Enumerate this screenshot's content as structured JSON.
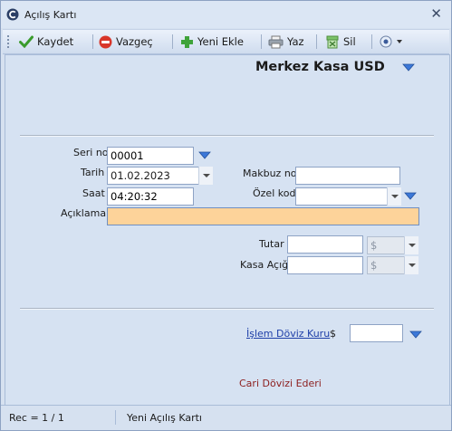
{
  "window": {
    "title": "Açılış Kartı",
    "close_glyph": "✕"
  },
  "toolbar": {
    "save_label": "Kaydet",
    "cancel_label": "Vazgeç",
    "new_label": "Yeni Ekle",
    "print_label": "Yaz",
    "delete_label": "Sil"
  },
  "header": {
    "title": "Merkez Kasa USD"
  },
  "form": {
    "seri_no_label": "Seri no",
    "seri_no_value": "00001",
    "tarih_label": "Tarih",
    "tarih_value": "01.02.2023",
    "saat_label": "Saat",
    "saat_value": "04:20:32",
    "makbuz_label": "Makbuz no",
    "makbuz_value": "",
    "ozel_kod_label": "Özel kod",
    "ozel_kod_value": "",
    "aciklama_label": "Açıklama",
    "aciklama_value": "",
    "tutar_label": "Tutar",
    "tutar_value": "",
    "tutar_currency": "$",
    "kasa_acigi_label": "Kasa Açığı",
    "kasa_acigi_value": "",
    "kasa_acigi_currency": "$",
    "islem_doviz_label": "İşlem Döviz Kuru",
    "islem_doviz_currency": "$",
    "islem_doviz_value": "",
    "cari_doviz_text": "Cari Dövizi Ederi"
  },
  "status": {
    "record": "Rec = 1 / 1",
    "mode": "Yeni Açılış Kartı"
  },
  "colors": {
    "window_bg": "#d6e1f0",
    "highlight_input": "#fdd39a",
    "link": "#1e3fa8",
    "cari_text": "#8c1e1e",
    "accent_arrow": "#3c78d8"
  }
}
